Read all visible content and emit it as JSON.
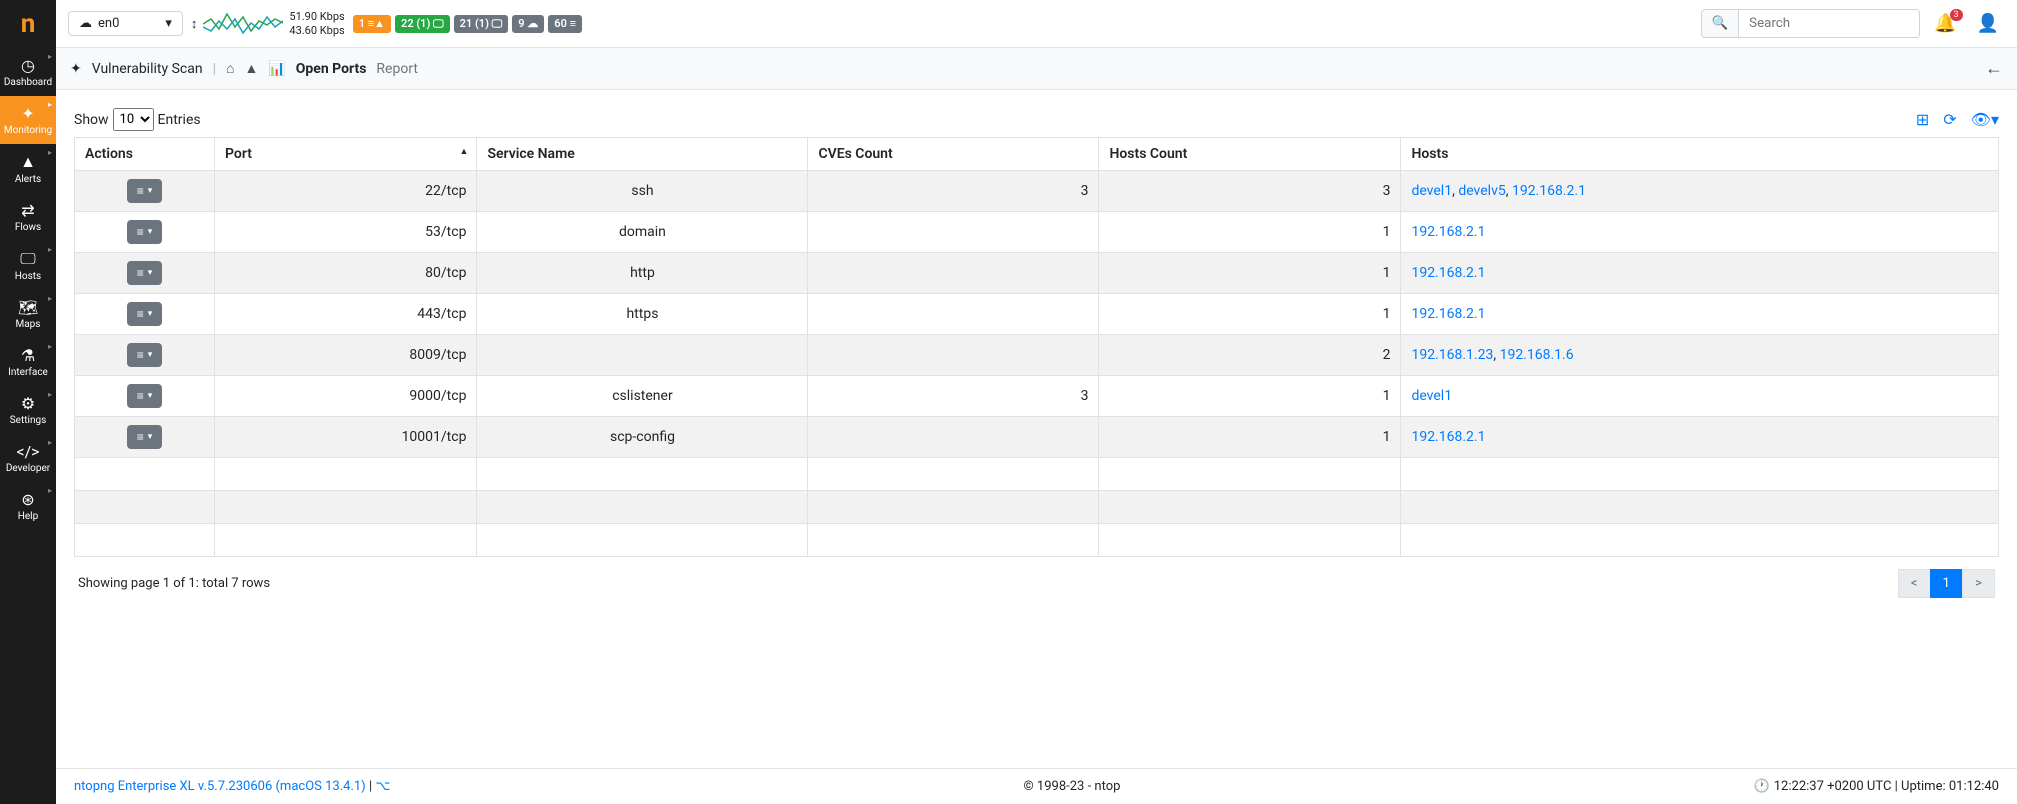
{
  "sidebar": {
    "items": [
      {
        "label": "Dashboard"
      },
      {
        "label": "Monitoring"
      },
      {
        "label": "Alerts"
      },
      {
        "label": "Flows"
      },
      {
        "label": "Hosts"
      },
      {
        "label": "Maps"
      },
      {
        "label": "Interface"
      },
      {
        "label": "Settings"
      },
      {
        "label": "Developer"
      },
      {
        "label": "Help"
      }
    ]
  },
  "topbar": {
    "iface": "en0",
    "up": "51.90 Kbps",
    "down": "43.60 Kbps",
    "badges": [
      {
        "text": "1",
        "icon": "≡▲",
        "cls": "orange"
      },
      {
        "text": "22 (1)",
        "icon": "🖵",
        "cls": "green"
      },
      {
        "text": "21 (1)",
        "icon": "🖵",
        "cls": "gray"
      },
      {
        "text": "9",
        "icon": "☁",
        "cls": "gray"
      },
      {
        "text": "60",
        "icon": "≡",
        "cls": "gray"
      }
    ],
    "search_placeholder": "Search",
    "notif_count": "3"
  },
  "pagehead": {
    "title": "Vulnerability Scan",
    "active": "Open Ports",
    "report": "Report"
  },
  "table": {
    "show_label_pre": "Show",
    "show_label_post": "Entries",
    "show_value": "10",
    "headers": [
      "Actions",
      "Port",
      "Service Name",
      "CVEs Count",
      "Hosts Count",
      "Hosts"
    ],
    "rows": [
      {
        "port": "22/tcp",
        "service": "ssh",
        "cves": "3",
        "hosts_count": "3",
        "hosts": [
          {
            "t": "devel1"
          },
          {
            "t": "develv5"
          },
          {
            "t": "192.168.2.1"
          }
        ]
      },
      {
        "port": "53/tcp",
        "service": "domain",
        "cves": "",
        "hosts_count": "1",
        "hosts": [
          {
            "t": "192.168.2.1"
          }
        ]
      },
      {
        "port": "80/tcp",
        "service": "http",
        "cves": "",
        "hosts_count": "1",
        "hosts": [
          {
            "t": "192.168.2.1"
          }
        ]
      },
      {
        "port": "443/tcp",
        "service": "https",
        "cves": "",
        "hosts_count": "1",
        "hosts": [
          {
            "t": "192.168.2.1"
          }
        ]
      },
      {
        "port": "8009/tcp",
        "service": "",
        "cves": "",
        "hosts_count": "2",
        "hosts": [
          {
            "t": "192.168.1.23"
          },
          {
            "t": "192.168.1.6"
          }
        ]
      },
      {
        "port": "9000/tcp",
        "service": "cslistener",
        "cves": "3",
        "hosts_count": "1",
        "hosts": [
          {
            "t": "devel1"
          }
        ]
      },
      {
        "port": "10001/tcp",
        "service": "scp-config",
        "cves": "",
        "hosts_count": "1",
        "hosts": [
          {
            "t": "192.168.2.1"
          }
        ]
      }
    ],
    "empty_rows": 3,
    "summary": "Showing page 1 of 1: total 7 rows",
    "pager": {
      "prev": "<",
      "page": "1",
      "next": ">"
    }
  },
  "footer": {
    "left": "ntopng Enterprise XL v.5.7.230606 (macOS 13.4.1)",
    "sep": " | ",
    "mid": "© 1998-23 - ntop",
    "time": "12:22:37 +0200 UTC | Uptime: 01:12:40"
  }
}
